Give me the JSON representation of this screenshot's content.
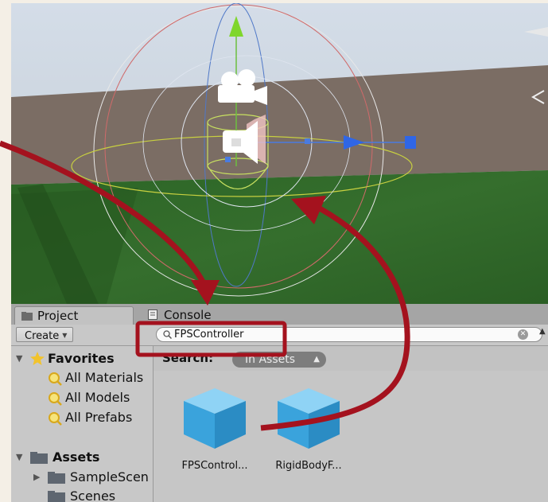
{
  "tabs": {
    "project": "Project",
    "console": "Console"
  },
  "toolbar": {
    "create_label": "Create",
    "search_value": "FPSController"
  },
  "favorites": {
    "title": "Favorites",
    "items": [
      "All Materials",
      "All Models",
      "All Prefabs"
    ]
  },
  "assets_tree": {
    "title": "Assets",
    "items": [
      "SampleScen",
      "Scenes"
    ]
  },
  "search_scope": {
    "label": "Search:",
    "value": "In Assets"
  },
  "grid_assets": [
    {
      "label": "FPSControl..."
    },
    {
      "label": "RigidBodyF..."
    }
  ],
  "colors": {
    "annotation": "#a4121e",
    "ground_green": "#2f6a27",
    "ground_brown": "#7a6a60",
    "cube_blue": "#3aa3dc"
  },
  "icons": [
    "camera-gizmo-icon",
    "audio-listener-gizmo-icon",
    "move-up-arrow-icon",
    "move-forward-arrow-icon",
    "search-icon",
    "folder-icon",
    "star-icon"
  ]
}
